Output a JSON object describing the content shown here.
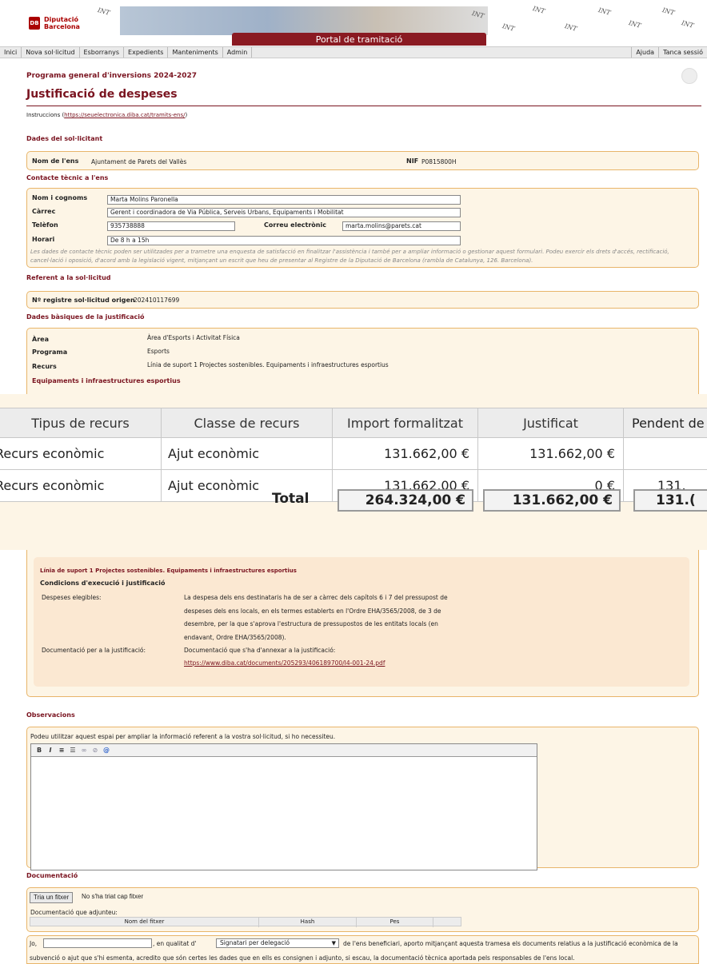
{
  "header": {
    "logo_line1": "Diputació",
    "logo_line2": "Barcelona",
    "logo_mark": "DB",
    "portal_title": "Portal de tramitació",
    "watermark": "INT"
  },
  "menu": {
    "items": [
      "Inici",
      "Nova sol·licitud",
      "Esborranys",
      "Expedients",
      "Manteniments",
      "Admin"
    ],
    "right": [
      "Ajuda",
      "Tanca sessió"
    ]
  },
  "page": {
    "program": "Programa general d'inversions 2024-2027",
    "title": "Justificació de despeses",
    "instructions_label": "Instruccions (",
    "instructions_link": "https://seuelectronica.diba.cat/tramits-ens/",
    "instructions_close": ")"
  },
  "applicant": {
    "section": "Dades del sol·licitant",
    "ens_label": "Nom de l'ens",
    "ens_value": "Ajuntament de Parets del Vallès",
    "nif_label": "NIF",
    "nif_value": "P0815800H"
  },
  "contact": {
    "section": "Contacte tècnic a l'ens",
    "name_label": "Nom i cognoms",
    "name_value": "Marta Molins Paronella",
    "role_label": "Càrrec",
    "role_value": "Gerent i coordinadora de Via Pública, Serveis Urbans, Equipaments i Mobilitat",
    "phone_label": "Telèfon",
    "phone_value": "935738888",
    "email_label": "Correu electrònic",
    "email_value": "marta.molins@parets.cat",
    "hours_label": "Horari",
    "hours_value": "De 8 h a 15h",
    "note": "Les dades de contacte tècnic poden ser utilitzades per a trametre una enquesta de satisfacció en finalitzar l'assistència i també per a ampliar informació o gestionar aquest formulari. Podeu exercir els drets d'accés, rectificació, cancel·lació i oposició, d'acord amb la legislació vigent, mitjançant un escrit que heu de presentar al Registre de la Diputació de Barcelona (rambla de Catalunya, 126. Barcelona)."
  },
  "referent": {
    "section": "Referent a la sol·licitud",
    "label": "Nº registre sol·licitud origen",
    "value": "202410117699"
  },
  "basics": {
    "section": "Dades bàsiques de la justificació",
    "area_label": "Àrea",
    "area_value": "Àrea d'Esports i Activitat Física",
    "program_label": "Programa",
    "program_value": "Esports",
    "resource_label": "Recurs",
    "resource_value": "Línia de suport 1 Projectes sostenibles. Equipaments i infraestructures esportius",
    "subsection": "Equipaments i infraestructures esportius"
  },
  "resources_table": {
    "headers": [
      "Tipus de recurs",
      "Classe de recurs",
      "Import formalitzat",
      "Justificat",
      "Pendent de"
    ],
    "rows": [
      [
        "Recurs econòmic",
        "Ajut econòmic",
        "131.662,00 €",
        "131.662,00 €",
        ""
      ],
      [
        "Recurs econòmic",
        "Ajut econòmic",
        "131.662,00 €",
        "0 €",
        "131."
      ]
    ],
    "total_label": "Total",
    "totals": [
      "264.324,00 €",
      "131.662,00 €",
      "131.("
    ]
  },
  "conditions": {
    "line_title": "Línia de suport 1 Projectes sostenibles. Equipaments i infraestructures esportius",
    "heading": "Condicions d'execució i justificació",
    "eligible_label": "Despeses elegibles:",
    "eligible_text": [
      "La despesa dels ens destinataris ha de ser a càrrec dels capítols 6 i 7 del pressupost de",
      "despeses dels ens locals, en els termes establerts en l'Ordre EHA/3565/2008, de 3 de",
      "desembre, per la que s'aprova l'estructura de pressupostos de les entitats locals (en",
      "endavant, Ordre EHA/3565/2008)."
    ],
    "doc_label": "Documentació per a la justificació:",
    "doc_text": "Documentació que s'ha d'annexar a la justificació:",
    "doc_link": "https://www.diba.cat/documents/205293/406189700/I4-001-24.pdf"
  },
  "observations": {
    "section": "Observacions",
    "hint": "Podeu utilitzar aquest espai per ampliar la informació referent a la vostra sol·licitud, si ho necessiteu.",
    "toolbar": [
      "B",
      "I",
      "≡",
      "☰",
      "∞",
      "⊘",
      "@"
    ]
  },
  "documentation": {
    "section": "Documentació",
    "choose_button": "Tria un fitxer",
    "no_file": "No s'ha triat cap fitxer",
    "attached_label": "Documentació que adjunteu:",
    "columns": [
      "Nom del fitxer",
      "Hash",
      "Pes"
    ]
  },
  "declaration": {
    "prefix": "Jo,",
    "middle": ", en qualitat d'",
    "select_value": "Signatari per delegació",
    "suffix": "de l'ens beneficiari, aporto mitjançant aquesta tramesa els documents relatius a la justificació econòmica de la",
    "line2": "subvenció o ajut que s'hi esmenta, acredito que són certes les dades que en ells es consignen i adjunto, si escau, la documentació tècnica aportada pels responsables de l'ens local."
  }
}
